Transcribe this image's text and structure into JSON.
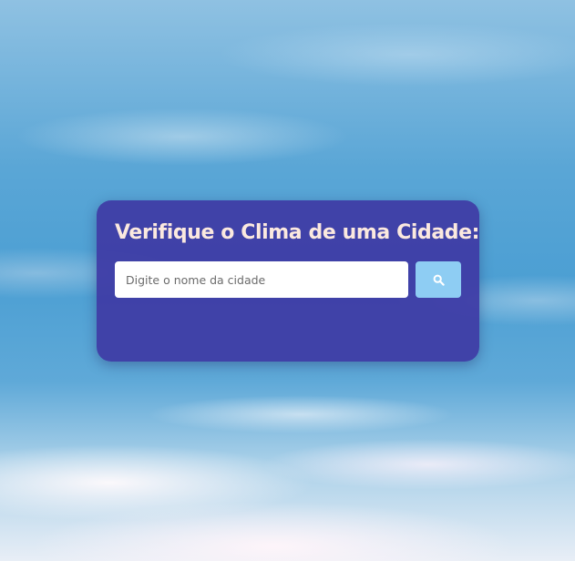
{
  "card": {
    "title": "Verifique o Clima de uma Cidade:",
    "search": {
      "placeholder": "Digite o nome da cidade",
      "value": "",
      "button_icon": "search-icon"
    }
  },
  "colors": {
    "card_background": "#3e3aa5",
    "title_text": "#fbe9df",
    "button_background": "#8ecdf3",
    "input_background": "#ffffff"
  }
}
